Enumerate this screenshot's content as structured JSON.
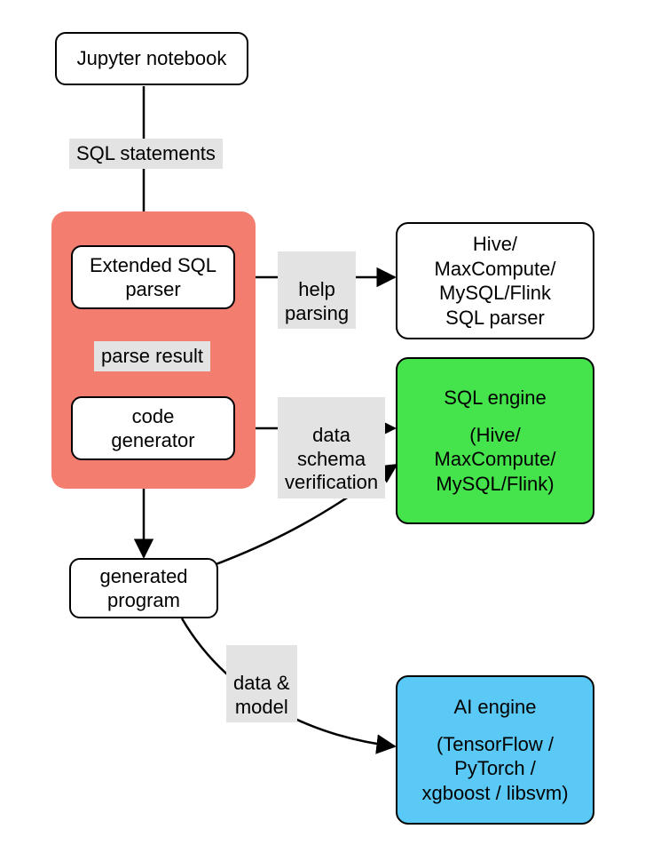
{
  "nodes": {
    "jupyter": "Jupyter notebook",
    "ext_sql_parser": "Extended SQL\nparser",
    "code_generator": "code\ngenerator",
    "hive_parser": "Hive/\nMaxCompute/\nMySQL/Flink\nSQL parser",
    "sql_engine_title": "SQL engine",
    "sql_engine_body": "(Hive/\nMaxCompute/\nMySQL/Flink)",
    "generated_program": "generated\nprogram",
    "ai_engine_title": "AI engine",
    "ai_engine_body": "(TensorFlow /\nPyTorch /\nxgboost / libsvm)"
  },
  "labels": {
    "sql_statements": "SQL statements",
    "parse_result": "parse result",
    "help_parsing": "help\nparsing",
    "data_schema_verification": "data\nschema\nverification",
    "data_model": "data &\nmodel"
  }
}
